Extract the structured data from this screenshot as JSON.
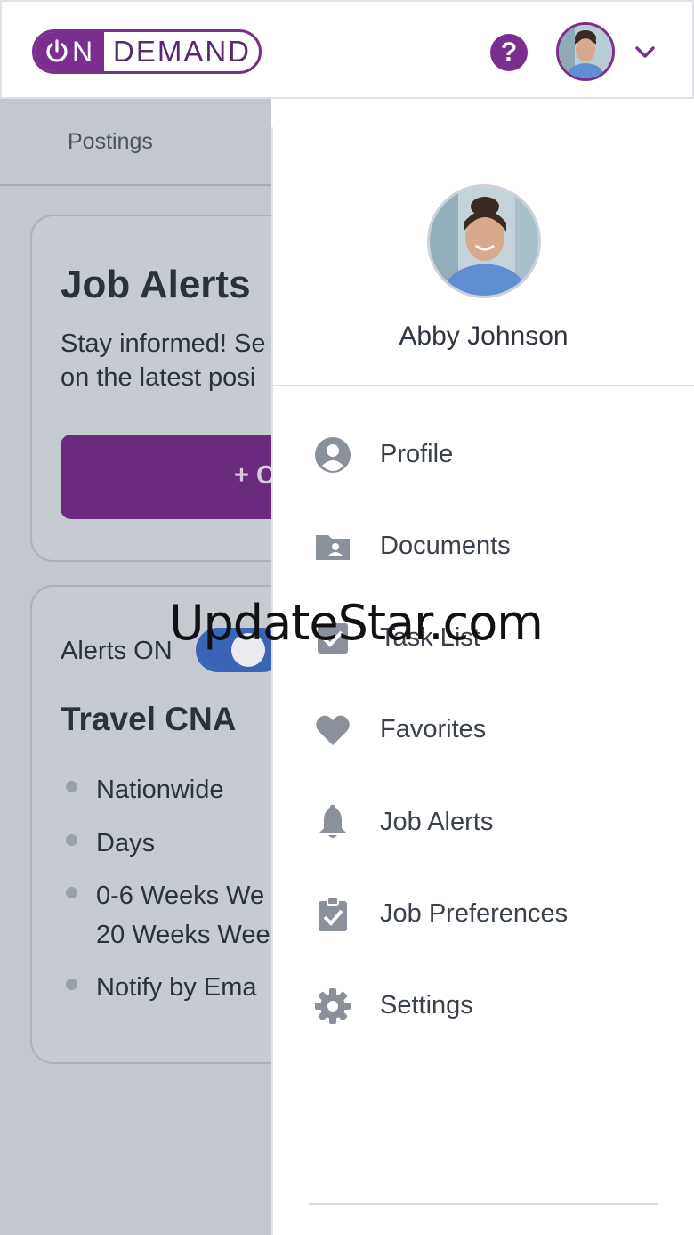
{
  "header": {
    "logo_on": "N",
    "logo_demand": "DEMAND",
    "help_symbol": "?",
    "colors": {
      "brand": "#7a2f8f"
    }
  },
  "background": {
    "tab_label": "Postings",
    "job_alerts_card": {
      "title": "Job Alerts",
      "text_line1": "Stay informed! Se",
      "text_line2": "on the latest posi",
      "create_button": "+ C"
    },
    "alert_card": {
      "toggle_label": "Alerts ON",
      "title": "Travel CNA",
      "criteria": [
        "Nationwide",
        "Days",
        "0-6 Weeks We",
        "20 Weeks Wee",
        "Notify by Ema"
      ]
    }
  },
  "drawer": {
    "user_name": "Abby Johnson",
    "menu": [
      {
        "label": "Profile",
        "icon": "profile-icon"
      },
      {
        "label": "Documents",
        "icon": "documents-icon"
      },
      {
        "label": "Task List",
        "icon": "task-list-icon"
      },
      {
        "label": "Favorites",
        "icon": "heart-icon"
      },
      {
        "label": "Job Alerts",
        "icon": "bell-icon"
      },
      {
        "label": "Job Preferences",
        "icon": "clipboard-check-icon"
      },
      {
        "label": "Settings",
        "icon": "gear-icon"
      }
    ]
  },
  "watermark": "UpdateStar.com"
}
